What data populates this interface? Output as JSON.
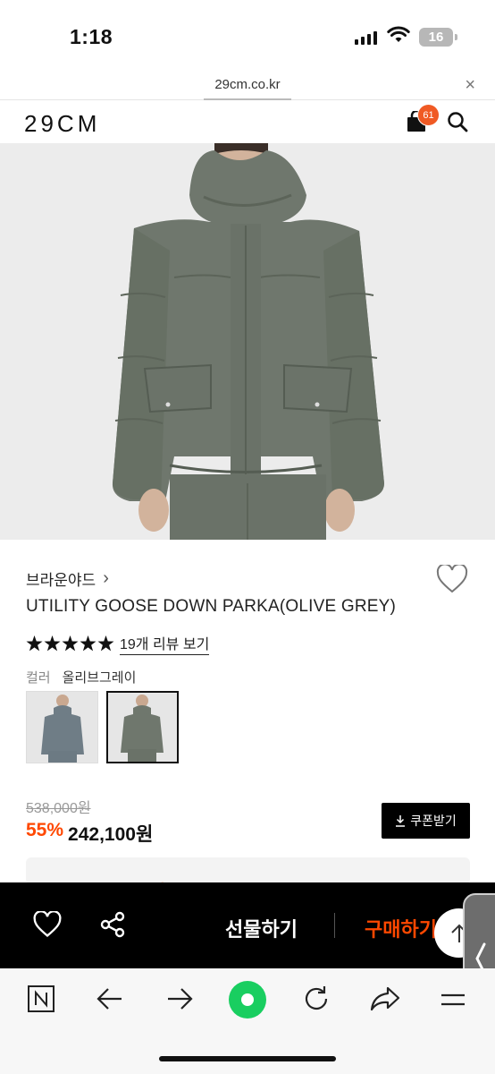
{
  "status_bar": {
    "time": "1:18",
    "battery": "16"
  },
  "browser": {
    "url": "29cm.co.kr",
    "close_glyph": "×"
  },
  "header": {
    "logo": "29CM",
    "cart_count": "61"
  },
  "product": {
    "brand": "브라운야드",
    "brand_chevron": "›",
    "name": "UTILITY GOOSE DOWN PARKA(OLIVE GREY)",
    "rating_stars": 5,
    "review_link": "19개 리뷰 보기",
    "color_label": "컬러",
    "color_value": "올리브그레이",
    "original_price": "538,000원",
    "discount": "55%",
    "price": "242,100원",
    "coupon_label": "쿠폰받기",
    "peek_text": "55% 242,100원"
  },
  "action_bar": {
    "gift_label": "선물하기",
    "buy_label": "구매하기"
  },
  "colors": {
    "accent": "#ff4800",
    "badge": "#f05a24",
    "naver_green": "#19ce60",
    "jacket": "#6f776d"
  },
  "icons": [
    "heart-icon",
    "share-icon",
    "arrow-up-icon",
    "chevron-left-icon",
    "naver-n-icon",
    "back-arrow-icon",
    "forward-arrow-icon",
    "refresh-icon",
    "share-forward-icon",
    "menu-icon",
    "search-icon",
    "bag-icon",
    "download-icon",
    "star-icon"
  ]
}
